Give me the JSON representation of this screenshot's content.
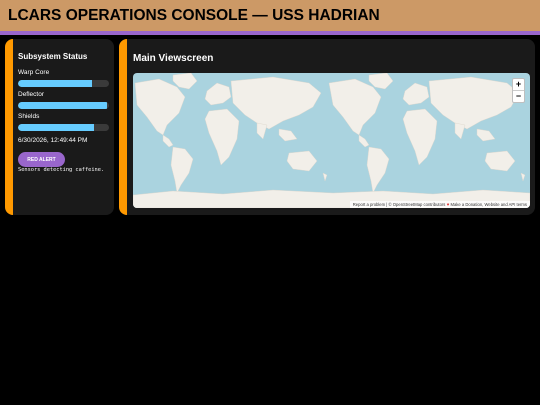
{
  "header": {
    "title": "LCARS OPERATIONS CONSOLE — USS HADRIAN"
  },
  "sidebar": {
    "title": "Subsystem Status",
    "subsystems": [
      {
        "label": "Warp Core",
        "level": 0.81
      },
      {
        "label": "Deflector",
        "level": 0.98
      },
      {
        "label": "Shields",
        "level": 0.84
      }
    ],
    "timestamp": "6/30/2026, 12:49:44 PM",
    "alert_button": "RED ALERT",
    "status_message": "Sensors detecting caffeine."
  },
  "main": {
    "title": "Main Viewscreen",
    "map": {
      "zoom_in": "+",
      "zoom_out": "−",
      "attribution": {
        "report": "Report a problem",
        "separator": " | © ",
        "osm": "OpenStreetMap contributors",
        "heart_icon": "heart-icon",
        "donate": "Make a Donation",
        "website": "Website and API terms"
      }
    }
  },
  "colors": {
    "header_bg": "#cc9966",
    "header_border": "#9966cc",
    "panel_stripe": "#ff9900",
    "bar_fill": "#66ccff",
    "alert_button": "#9966cc",
    "water": "#aad3df",
    "land": "#f2efe9"
  }
}
